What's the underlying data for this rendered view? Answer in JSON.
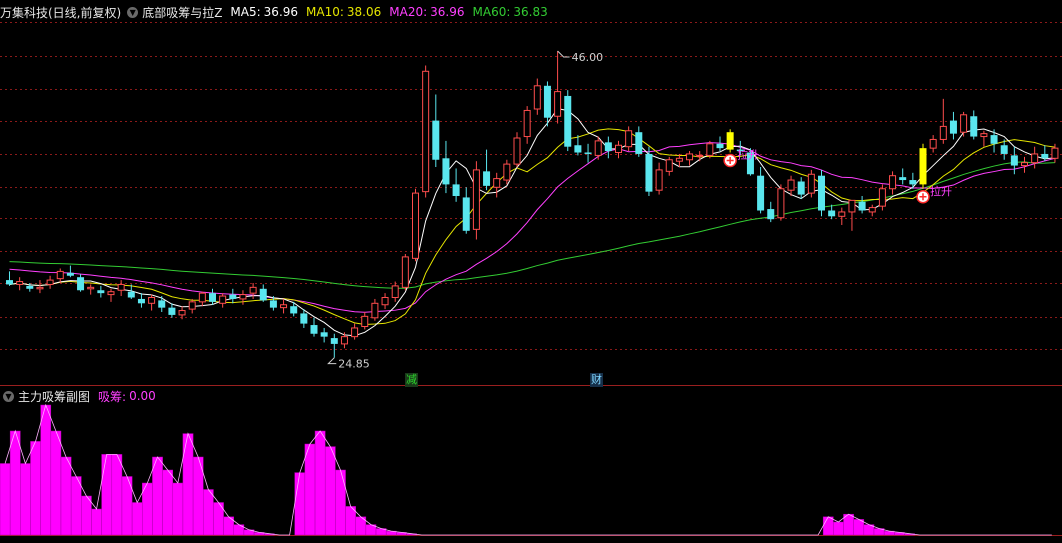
{
  "header": {
    "stock_title": "万集科技(日线,前复权)",
    "indicator_name": "底部吸筹与拉Z",
    "ma5_label": "MA5:",
    "ma5_value": "36.96",
    "ma10_label": "MA10:",
    "ma10_value": "38.06",
    "ma20_label": "MA20:",
    "ma20_value": "36.96",
    "ma60_label": "MA60:",
    "ma60_value": "36.83"
  },
  "price_panel": {
    "high_label": "46.00",
    "low_label": "24.85",
    "signal_labels": [
      "拉升",
      "拉升"
    ],
    "event_tags": [
      "减",
      "财"
    ]
  },
  "sub_panel": {
    "title": "主力吸筹副图",
    "series_label": "吸筹:",
    "series_value": "0.00"
  },
  "colors": {
    "up": "#ff4d4d",
    "down": "#5ae6ee",
    "ma5": "#ffffff",
    "ma10": "#e6e600",
    "ma20": "#ff40ff",
    "ma60": "#33cc33",
    "grid": "#8b1a1a",
    "bar": "#ff00ff",
    "signal": "#ffff00"
  },
  "chart_data": [
    {
      "type": "candlestick",
      "title": "万集科技(日线,前复权)",
      "ylim": [
        24,
        48
      ],
      "y_max_marker": 46.0,
      "y_min_marker": 24.85,
      "candles": [
        [
          30.2,
          30.8,
          29.8,
          29.9
        ],
        [
          29.9,
          30.4,
          29.5,
          30.1
        ],
        [
          29.8,
          30.0,
          29.4,
          29.6
        ],
        [
          29.6,
          30.2,
          29.3,
          29.7
        ],
        [
          29.9,
          30.5,
          29.6,
          30.2
        ],
        [
          30.3,
          31.0,
          30.0,
          30.8
        ],
        [
          30.7,
          31.2,
          30.4,
          30.5
        ],
        [
          30.4,
          30.6,
          29.4,
          29.5
        ],
        [
          29.6,
          29.9,
          29.2,
          29.7
        ],
        [
          29.5,
          29.8,
          29.0,
          29.3
        ],
        [
          29.2,
          29.6,
          28.7,
          29.4
        ],
        [
          29.5,
          30.2,
          29.1,
          29.9
        ],
        [
          29.4,
          29.9,
          28.9,
          29.0
        ],
        [
          28.9,
          29.3,
          28.3,
          28.6
        ],
        [
          28.6,
          29.2,
          28.1,
          29.0
        ],
        [
          28.8,
          29.1,
          28.0,
          28.3
        ],
        [
          28.3,
          28.6,
          27.6,
          27.8
        ],
        [
          27.8,
          28.4,
          27.5,
          28.1
        ],
        [
          28.2,
          28.9,
          27.9,
          28.7
        ],
        [
          28.7,
          29.4,
          28.4,
          29.3
        ],
        [
          29.3,
          29.6,
          28.5,
          28.7
        ],
        [
          28.6,
          29.3,
          28.3,
          29.1
        ],
        [
          29.2,
          29.6,
          28.6,
          28.9
        ],
        [
          28.9,
          29.5,
          28.5,
          29.2
        ],
        [
          29.3,
          30.0,
          28.9,
          29.7
        ],
        [
          29.6,
          29.9,
          28.7,
          28.8
        ],
        [
          28.8,
          29.1,
          28.1,
          28.3
        ],
        [
          28.3,
          28.9,
          27.9,
          28.5
        ],
        [
          28.4,
          28.7,
          27.7,
          27.9
        ],
        [
          27.9,
          28.2,
          26.9,
          27.2
        ],
        [
          27.1,
          27.6,
          26.3,
          26.5
        ],
        [
          26.6,
          26.9,
          25.9,
          26.3
        ],
        [
          26.2,
          26.5,
          24.85,
          25.8
        ],
        [
          25.8,
          26.6,
          25.5,
          26.3
        ],
        [
          26.3,
          27.2,
          26.1,
          26.9
        ],
        [
          27.0,
          28.0,
          26.8,
          27.7
        ],
        [
          27.6,
          28.9,
          27.4,
          28.6
        ],
        [
          28.5,
          29.3,
          28.2,
          29.0
        ],
        [
          29.0,
          30.1,
          28.7,
          29.8
        ],
        [
          29.7,
          32.0,
          29.5,
          31.8
        ],
        [
          31.7,
          36.5,
          31.5,
          36.2
        ],
        [
          36.3,
          45.0,
          35.9,
          44.6
        ],
        [
          41.2,
          43.0,
          38.0,
          38.5
        ],
        [
          38.6,
          39.8,
          36.2,
          36.8
        ],
        [
          36.8,
          37.9,
          35.6,
          36.0
        ],
        [
          35.9,
          36.6,
          33.4,
          33.6
        ],
        [
          33.7,
          38.4,
          33.0,
          37.8
        ],
        [
          37.7,
          39.2,
          36.4,
          36.7
        ],
        [
          36.6,
          37.6,
          35.9,
          37.2
        ],
        [
          37.1,
          38.5,
          36.8,
          38.2
        ],
        [
          38.2,
          40.4,
          38.0,
          40.0
        ],
        [
          40.1,
          42.2,
          39.6,
          41.9
        ],
        [
          42.0,
          44.1,
          41.6,
          43.6
        ],
        [
          43.6,
          43.9,
          40.8,
          41.4
        ],
        [
          41.5,
          46.0,
          41.0,
          43.2
        ],
        [
          42.9,
          43.3,
          39.1,
          39.4
        ],
        [
          39.5,
          40.2,
          38.8,
          39.0
        ],
        [
          39.0,
          39.6,
          38.3,
          38.9
        ],
        [
          38.8,
          40.1,
          38.5,
          39.8
        ],
        [
          39.7,
          40.1,
          38.6,
          39.1
        ],
        [
          39.0,
          39.8,
          38.6,
          39.5
        ],
        [
          39.4,
          40.8,
          39.1,
          40.5
        ],
        [
          40.4,
          40.8,
          38.7,
          38.9
        ],
        [
          38.9,
          39.4,
          36.0,
          36.3
        ],
        [
          36.4,
          38.3,
          36.1,
          37.8
        ],
        [
          37.7,
          38.7,
          37.4,
          38.5
        ],
        [
          38.4,
          38.9,
          38.0,
          38.6
        ],
        [
          38.5,
          39.1,
          38.1,
          38.9
        ],
        [
          38.8,
          39.1,
          38.4,
          38.8
        ],
        [
          38.8,
          39.8,
          38.6,
          39.6
        ],
        [
          39.6,
          40.1,
          39.1,
          39.3
        ],
        [
          39.2,
          40.6,
          39.0,
          40.4
        ],
        [
          39.2,
          39.8,
          38.8,
          39.1
        ],
        [
          39.0,
          39.3,
          37.4,
          37.5
        ],
        [
          37.4,
          38.0,
          34.8,
          35.0
        ],
        [
          35.1,
          35.6,
          34.2,
          34.4
        ],
        [
          34.5,
          36.8,
          34.3,
          36.5
        ],
        [
          36.4,
          37.4,
          36.0,
          37.1
        ],
        [
          37.0,
          37.3,
          35.8,
          36.1
        ],
        [
          36.2,
          37.8,
          35.9,
          37.5
        ],
        [
          37.4,
          37.8,
          34.6,
          35.0
        ],
        [
          35.0,
          35.4,
          34.4,
          34.6
        ],
        [
          34.6,
          35.2,
          34.0,
          34.9
        ],
        [
          34.9,
          35.3,
          33.6,
          35.7
        ],
        [
          35.6,
          36.0,
          34.8,
          35.0
        ],
        [
          34.9,
          35.4,
          34.6,
          35.2
        ],
        [
          35.3,
          36.8,
          35.0,
          36.5
        ],
        [
          36.5,
          37.7,
          36.1,
          37.4
        ],
        [
          37.3,
          37.9,
          36.8,
          37.1
        ],
        [
          37.1,
          37.6,
          36.5,
          36.8
        ],
        [
          36.8,
          39.6,
          36.5,
          39.3
        ],
        [
          39.3,
          40.2,
          39.0,
          39.9
        ],
        [
          39.9,
          42.7,
          39.6,
          40.8
        ],
        [
          41.2,
          41.8,
          39.9,
          40.3
        ],
        [
          40.4,
          41.8,
          40.1,
          41.6
        ],
        [
          41.5,
          41.9,
          39.9,
          40.1
        ],
        [
          40.1,
          40.5,
          39.4,
          40.3
        ],
        [
          40.2,
          40.6,
          39.0,
          39.6
        ],
        [
          39.5,
          39.9,
          38.5,
          38.9
        ],
        [
          38.8,
          39.4,
          37.5,
          38.1
        ],
        [
          38.1,
          38.7,
          37.6,
          38.3
        ],
        [
          38.3,
          39.4,
          37.9,
          38.9
        ],
        [
          38.9,
          39.5,
          38.4,
          38.6
        ],
        [
          38.6,
          39.6,
          38.3,
          39.3
        ]
      ],
      "signals": [
        {
          "index": 71,
          "label": "拉升"
        },
        {
          "index": 90,
          "label": "拉升"
        }
      ],
      "series": [
        {
          "name": "MA5",
          "value_last": 36.96
        },
        {
          "name": "MA10",
          "value_last": 38.06
        },
        {
          "name": "MA20",
          "value_last": 36.96
        },
        {
          "name": "MA60",
          "value_last": 36.83
        }
      ]
    },
    {
      "type": "bar",
      "title": "主力吸筹副图",
      "series": [
        {
          "name": "吸筹",
          "value_last": 0.0
        }
      ],
      "ylim": [
        0,
        100
      ],
      "values": [
        55,
        80,
        55,
        72,
        100,
        80,
        60,
        45,
        30,
        20,
        62,
        62,
        45,
        25,
        40,
        60,
        50,
        40,
        78,
        60,
        35,
        25,
        14,
        8,
        4,
        2,
        1,
        0,
        0,
        48,
        70,
        80,
        68,
        50,
        22,
        14,
        8,
        5,
        3,
        2,
        1,
        0,
        0,
        0,
        0,
        0,
        0,
        0,
        0,
        0,
        0,
        0,
        0,
        0,
        0,
        0,
        0,
        0,
        0,
        0,
        0,
        0,
        0,
        0,
        0,
        0,
        0,
        0,
        0,
        0,
        0,
        0,
        0,
        0,
        0,
        0,
        0,
        0,
        0,
        0,
        0,
        14,
        10,
        16,
        12,
        8,
        5,
        3,
        2,
        1,
        0,
        0,
        0,
        0,
        0,
        0,
        0,
        0,
        0,
        0,
        0,
        0,
        0,
        0
      ]
    }
  ]
}
